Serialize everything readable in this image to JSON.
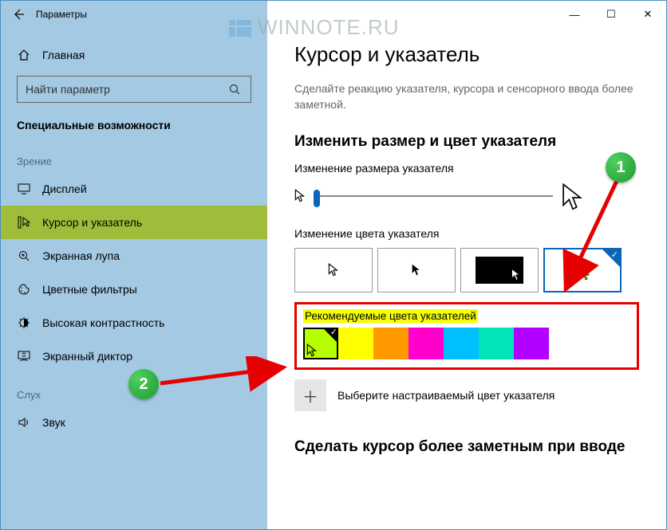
{
  "window": {
    "title": "Параметры"
  },
  "titlebar": {
    "min": "—",
    "max": "☐",
    "close": "✕"
  },
  "watermark": "WINNOTE.RU",
  "sidebar": {
    "home": "Главная",
    "search_placeholder": "Найти параметр",
    "category": "Специальные возможности",
    "group_vision": "Зрение",
    "items_vision": [
      {
        "label": "Дисплей"
      },
      {
        "label": "Курсор и указатель"
      },
      {
        "label": "Экранная лупа"
      },
      {
        "label": "Цветные фильтры"
      },
      {
        "label": "Высокая контрастность"
      },
      {
        "label": "Экранный диктор"
      }
    ],
    "group_hearing": "Слух",
    "items_hearing": [
      {
        "label": "Звук"
      }
    ]
  },
  "main": {
    "heading": "Курсор и указатель",
    "description": "Сделайте реакцию указателя, курсора и сенсорного ввода более заметной.",
    "section_size": "Изменить размер и цвет указателя",
    "size_label": "Изменение размера указателя",
    "color_label": "Изменение цвета указателя",
    "reco_title": "Рекомендуемые цвета указателей",
    "reco_colors": [
      "#b6ff00",
      "#ffff00",
      "#ff9900",
      "#ff00cc",
      "#00bfff",
      "#00e6b8",
      "#b000ff"
    ],
    "custom_label": "Выберите настраиваемый цвет указателя",
    "section_caret": "Сделать курсор более заметным при вводе"
  },
  "callouts": {
    "one": "1",
    "two": "2"
  }
}
